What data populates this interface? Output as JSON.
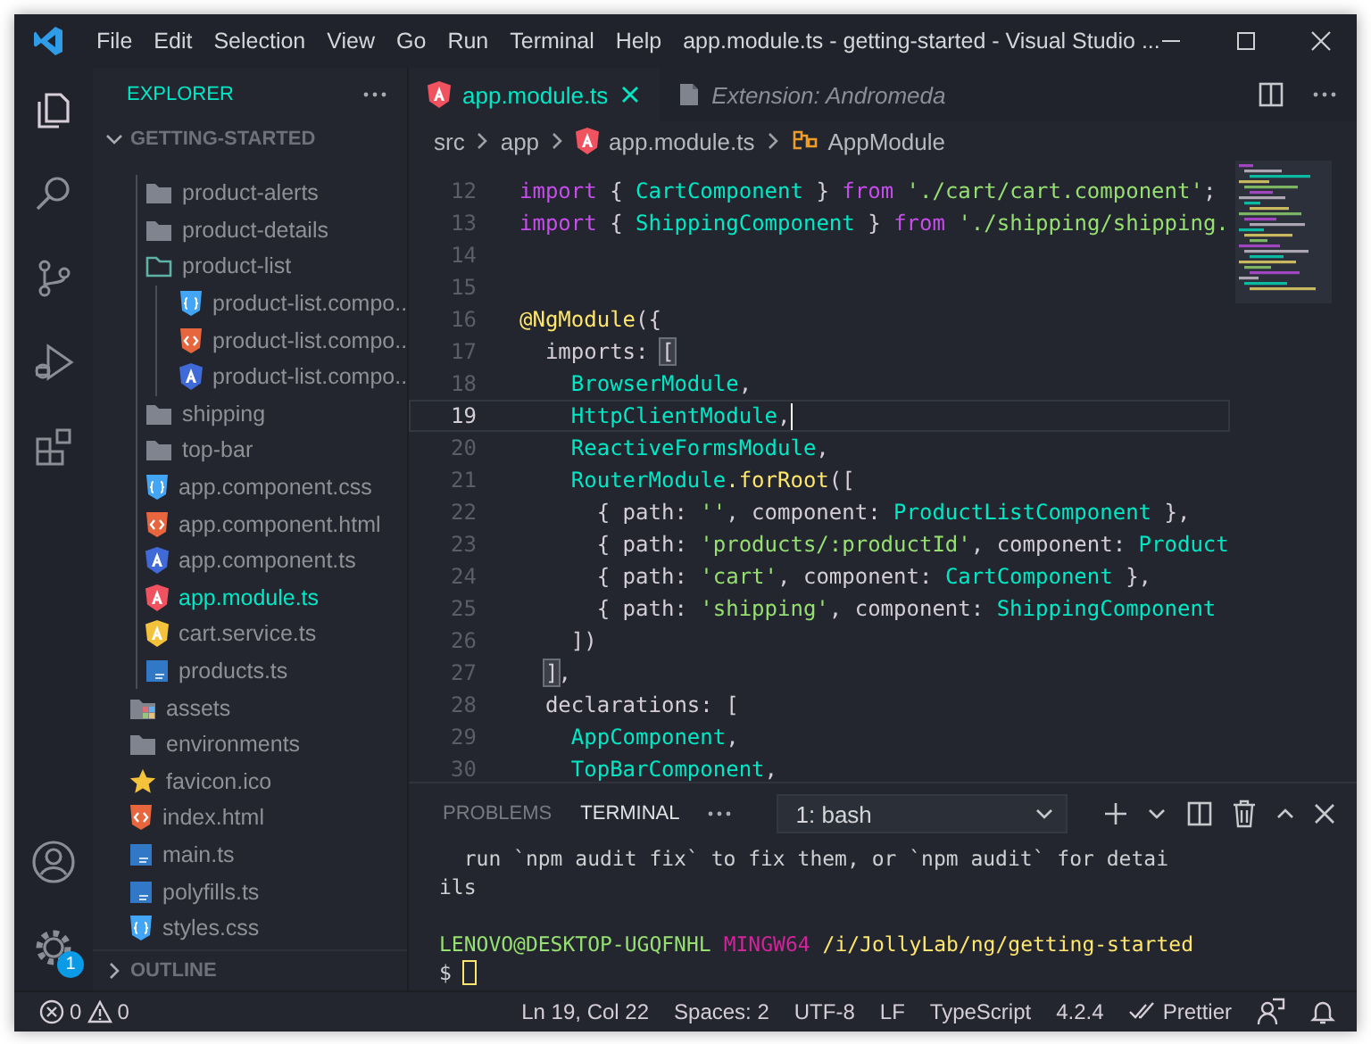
{
  "window": {
    "title": "app.module.ts - getting-started - Visual Studio ..."
  },
  "menu": [
    "File",
    "Edit",
    "Selection",
    "View",
    "Go",
    "Run",
    "Terminal",
    "Help"
  ],
  "activity_bar": {
    "items": [
      {
        "kind": "files",
        "selected": true
      },
      {
        "kind": "search",
        "selected": false
      },
      {
        "kind": "source-control",
        "selected": false
      },
      {
        "kind": "run",
        "selected": false
      },
      {
        "kind": "extensions",
        "selected": false
      }
    ],
    "bottom": [
      {
        "kind": "account"
      },
      {
        "kind": "settings",
        "badge": "1"
      }
    ]
  },
  "sidebar": {
    "title": "EXPLORER",
    "folder": {
      "label": "GETTING-STARTED",
      "expanded": true
    },
    "tree": [
      {
        "children": [
          {
            "label": "product-alerts",
            "kind": "folder",
            "expanded": false,
            "selected": false
          },
          {
            "label": "product-details",
            "kind": "folder",
            "expanded": false,
            "selected": false
          },
          {
            "label": "product-list",
            "kind": "folder",
            "expanded": true,
            "selected": false,
            "children": [
              {
                "label": "product-list.compo...",
                "kind": "css",
                "selected": false
              },
              {
                "label": "product-list.compo...",
                "kind": "html",
                "selected": false
              },
              {
                "label": "product-list.compo...",
                "kind": "angular-component",
                "selected": false
              }
            ]
          },
          {
            "label": "shipping",
            "kind": "folder",
            "expanded": false,
            "selected": false
          },
          {
            "label": "top-bar",
            "kind": "folder",
            "expanded": false,
            "selected": false
          },
          {
            "label": "app.component.css",
            "kind": "css",
            "selected": false
          },
          {
            "label": "app.component.html",
            "kind": "html",
            "selected": false
          },
          {
            "label": "app.component.ts",
            "kind": "angular-component",
            "selected": false
          },
          {
            "label": "app.module.ts",
            "kind": "angular-module",
            "selected": true
          },
          {
            "label": "cart.service.ts",
            "kind": "angular-service",
            "selected": false
          },
          {
            "label": "products.ts",
            "kind": "ts",
            "selected": false
          }
        ]
      },
      {
        "label": "assets",
        "kind": "assets-folder",
        "expanded": false,
        "selected": false
      },
      {
        "label": "environments",
        "kind": "folder",
        "expanded": false,
        "selected": false
      },
      {
        "label": "favicon.ico",
        "kind": "favicon",
        "selected": false
      },
      {
        "label": "index.html",
        "kind": "html",
        "selected": false
      },
      {
        "label": "main.ts",
        "kind": "ts",
        "selected": false
      },
      {
        "label": "polyfills.ts",
        "kind": "ts",
        "selected": false
      },
      {
        "label": "styles.css",
        "kind": "css",
        "selected": false
      }
    ],
    "outline": {
      "label": "OUTLINE",
      "expanded": false
    }
  },
  "editor": {
    "tabs": [
      {
        "label": "app.module.ts",
        "kind": "angular-module",
        "selected": true,
        "preview": false
      },
      {
        "label": "Extension: Andromeda",
        "kind": "extension",
        "selected": false,
        "preview": true
      }
    ],
    "breadcrumb": [
      {
        "label": "src"
      },
      {
        "label": "app"
      },
      {
        "label": "app.module.ts",
        "kind": "angular-module"
      },
      {
        "label": "AppModule",
        "kind": "class"
      }
    ],
    "lines": [
      {
        "number": "12",
        "current": false,
        "tokens": [
          {
            "kind": "keyword",
            "s": "import"
          },
          {
            "kind": "plain",
            "s": " { "
          },
          {
            "kind": "class",
            "s": "CartComponent"
          },
          {
            "kind": "plain",
            "s": " } "
          },
          {
            "kind": "keyword",
            "s": "from"
          },
          {
            "kind": "string",
            "s": " './cart/cart.component'"
          },
          {
            "kind": "plain",
            "s": ";"
          }
        ]
      },
      {
        "number": "13",
        "current": false,
        "tokens": [
          {
            "kind": "keyword",
            "s": "import"
          },
          {
            "kind": "plain",
            "s": " { "
          },
          {
            "kind": "class",
            "s": "ShippingComponent"
          },
          {
            "kind": "plain",
            "s": " } "
          },
          {
            "kind": "keyword",
            "s": "from"
          },
          {
            "kind": "string",
            "s": " './shipping/shipping."
          }
        ]
      },
      {
        "number": "14",
        "current": false
      },
      {
        "number": "15",
        "current": false
      },
      {
        "number": "16",
        "current": false,
        "tokens": [
          {
            "kind": "function",
            "s": "@NgModule"
          },
          {
            "kind": "plain",
            "s": "({"
          }
        ]
      },
      {
        "number": "17",
        "current": false,
        "tokens": [
          {
            "kind": "plain",
            "s": "  imports: "
          },
          {
            "kind": "match",
            "s": "["
          }
        ]
      },
      {
        "number": "18",
        "current": false,
        "tokens": [
          {
            "kind": "class",
            "s": "    BrowserModule"
          },
          {
            "kind": "plain",
            "s": ","
          }
        ]
      },
      {
        "number": "19",
        "current": true,
        "tokens": [
          {
            "kind": "class",
            "s": "    HttpClientModule"
          },
          {
            "kind": "plain",
            "s": ","
          }
        ]
      },
      {
        "number": "20",
        "current": false,
        "tokens": [
          {
            "kind": "class",
            "s": "    ReactiveFormsModule"
          },
          {
            "kind": "plain",
            "s": ","
          }
        ]
      },
      {
        "number": "21",
        "current": false,
        "tokens": [
          {
            "kind": "class",
            "s": "    RouterModule"
          },
          {
            "kind": "function",
            "s": ".forRoot"
          },
          {
            "kind": "plain",
            "s": "(["
          }
        ]
      },
      {
        "number": "22",
        "current": false,
        "tokens": [
          {
            "kind": "plain",
            "s": "      { path: "
          },
          {
            "kind": "string",
            "s": "''"
          },
          {
            "kind": "plain",
            "s": ", component: "
          },
          {
            "kind": "class",
            "s": "ProductListComponent"
          },
          {
            "kind": "plain",
            "s": " },"
          }
        ]
      },
      {
        "number": "23",
        "current": false,
        "tokens": [
          {
            "kind": "plain",
            "s": "      { path: "
          },
          {
            "kind": "string",
            "s": "'products/:productId'"
          },
          {
            "kind": "plain",
            "s": ", component: "
          },
          {
            "kind": "class",
            "s": "Product"
          }
        ]
      },
      {
        "number": "24",
        "current": false,
        "tokens": [
          {
            "kind": "plain",
            "s": "      { path: "
          },
          {
            "kind": "string",
            "s": "'cart'"
          },
          {
            "kind": "plain",
            "s": ", component: "
          },
          {
            "kind": "class",
            "s": "CartComponent"
          },
          {
            "kind": "plain",
            "s": " },"
          }
        ]
      },
      {
        "number": "25",
        "current": false,
        "tokens": [
          {
            "kind": "plain",
            "s": "      { path: "
          },
          {
            "kind": "string",
            "s": "'shipping'"
          },
          {
            "kind": "plain",
            "s": ", component: "
          },
          {
            "kind": "class",
            "s": "ShippingComponent"
          }
        ]
      },
      {
        "number": "26",
        "current": false,
        "tokens": [
          {
            "kind": "plain",
            "s": "    ])"
          }
        ]
      },
      {
        "number": "27",
        "current": false,
        "tokens": [
          {
            "kind": "match",
            "s": "  ]"
          },
          {
            "kind": "plain",
            "s": ","
          }
        ]
      },
      {
        "number": "28",
        "current": false,
        "tokens": [
          {
            "kind": "plain",
            "s": "  declarations: ["
          }
        ]
      },
      {
        "number": "29",
        "current": false,
        "tokens": [
          {
            "kind": "class",
            "s": "    AppComponent"
          },
          {
            "kind": "plain",
            "s": ","
          }
        ]
      },
      {
        "number": "30",
        "current": false,
        "tokens": [
          {
            "kind": "class",
            "s": "    TopBarComponent"
          },
          {
            "kind": "plain",
            "s": ","
          }
        ]
      }
    ]
  },
  "panel": {
    "tabs": [
      {
        "label": "PROBLEMS",
        "selected": false
      },
      {
        "label": "TERMINAL",
        "selected": true
      }
    ],
    "terminal_select": {
      "value": "1: bash"
    },
    "terminal_lines": [
      {
        "kind": "output",
        "segments": [
          {
            "kind": "plain",
            "s": "  run `npm audit fix` to fix them, or `npm audit` for detai"
          }
        ]
      },
      {
        "kind": "output",
        "segments": [
          {
            "kind": "plain",
            "s": "ils"
          }
        ]
      },
      {
        "kind": "prompt",
        "segments": [
          {
            "kind": "user",
            "s": "LENOVO@DESKTOP-UGQFNHL"
          },
          {
            "kind": "system",
            "s": "MINGW64"
          },
          {
            "kind": "path",
            "s": "/i/JollyLab/ng/getting-started"
          }
        ]
      },
      {
        "kind": "input",
        "segments": [
          {
            "kind": "plain",
            "s": "$"
          }
        ]
      }
    ]
  },
  "status_bar": {
    "errors": "0",
    "warnings": "0",
    "items": [
      {
        "kind": "text",
        "label": "Ln 19, Col 22"
      },
      {
        "kind": "text",
        "label": "Spaces: 2"
      },
      {
        "kind": "text",
        "label": "UTF-8"
      },
      {
        "kind": "text",
        "label": "LF"
      },
      {
        "kind": "text",
        "label": "TypeScript"
      },
      {
        "kind": "text",
        "label": "4.2.4"
      },
      {
        "kind": "check",
        "label": "Prettier"
      },
      {
        "kind": "feedback"
      },
      {
        "kind": "bell"
      }
    ]
  }
}
